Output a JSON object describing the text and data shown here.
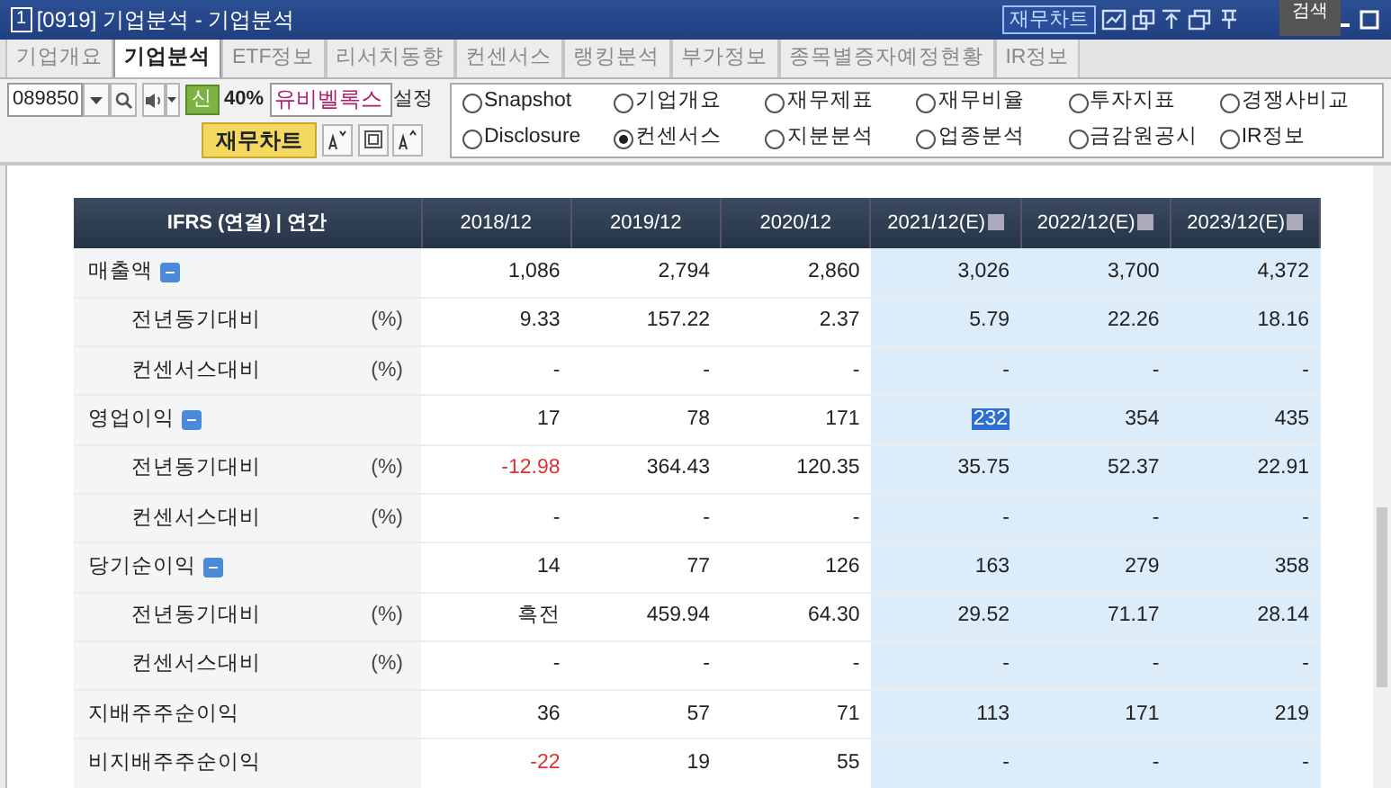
{
  "window": {
    "number": "1",
    "title": "[0919] 기업분석 - 기업분석",
    "chart_button": "재무차트",
    "tooltip": "검색"
  },
  "tabs": [
    {
      "label": "기업개요",
      "selected": false
    },
    {
      "label": "기업분석",
      "selected": true
    },
    {
      "label": "ETF정보",
      "selected": false
    },
    {
      "label": "리서치동향",
      "selected": false
    },
    {
      "label": "컨센서스",
      "selected": false
    },
    {
      "label": "랭킹분석",
      "selected": false
    },
    {
      "label": "부가정보",
      "selected": false
    },
    {
      "label": "종목별증자예정현황",
      "selected": false
    },
    {
      "label": "IR정보",
      "selected": false
    }
  ],
  "stock": {
    "code": "089850",
    "badge": "신",
    "ratio": "40%",
    "name": "유비벨록스",
    "settings": "설정",
    "chart_button": "재무차트"
  },
  "radios": [
    {
      "label": "Snapshot",
      "selected": false
    },
    {
      "label": "기업개요",
      "selected": false
    },
    {
      "label": "재무제표",
      "selected": false
    },
    {
      "label": "재무비율",
      "selected": false
    },
    {
      "label": "투자지표",
      "selected": false
    },
    {
      "label": "경쟁사비교",
      "selected": false
    },
    {
      "label": "Disclosure",
      "selected": false
    },
    {
      "label": "컨센서스",
      "selected": true
    },
    {
      "label": "지분분석",
      "selected": false
    },
    {
      "label": "업종분석",
      "selected": false
    },
    {
      "label": "금감원공시",
      "selected": false
    },
    {
      "label": "IR정보",
      "selected": false
    }
  ],
  "table": {
    "header": "IFRS (연결) | 연간",
    "columns": [
      {
        "label": "2018/12",
        "estimate": false
      },
      {
        "label": "2019/12",
        "estimate": false
      },
      {
        "label": "2020/12",
        "estimate": false
      },
      {
        "label": "2021/12(E)",
        "estimate": true
      },
      {
        "label": "2022/12(E)",
        "estimate": true
      },
      {
        "label": "2023/12(E)",
        "estimate": true
      }
    ],
    "rows": [
      {
        "kind": "main",
        "label": "매출액",
        "collapsible": true,
        "cells": [
          {
            "text": "1,086"
          },
          {
            "text": "2,794"
          },
          {
            "text": "2,860"
          },
          {
            "text": "3,026"
          },
          {
            "text": "3,700"
          },
          {
            "text": "4,372"
          }
        ]
      },
      {
        "kind": "sub",
        "label": "전년동기대비",
        "unit": "(%)",
        "cells": [
          {
            "text": "9.33"
          },
          {
            "text": "157.22"
          },
          {
            "text": "2.37"
          },
          {
            "text": "5.79"
          },
          {
            "text": "22.26"
          },
          {
            "text": "18.16"
          }
        ]
      },
      {
        "kind": "sub",
        "label": "컨센서스대비",
        "unit": "(%)",
        "cells": [
          {
            "text": "-"
          },
          {
            "text": "-"
          },
          {
            "text": "-"
          },
          {
            "text": "-"
          },
          {
            "text": "-"
          },
          {
            "text": "-"
          }
        ]
      },
      {
        "kind": "main",
        "label": "영업이익",
        "collapsible": true,
        "cells": [
          {
            "text": "17"
          },
          {
            "text": "78"
          },
          {
            "text": "171"
          },
          {
            "text": "232",
            "selected": true
          },
          {
            "text": "354"
          },
          {
            "text": "435"
          }
        ]
      },
      {
        "kind": "sub",
        "label": "전년동기대비",
        "unit": "(%)",
        "cells": [
          {
            "text": "-12.98",
            "negative": true
          },
          {
            "text": "364.43"
          },
          {
            "text": "120.35"
          },
          {
            "text": "35.75"
          },
          {
            "text": "52.37"
          },
          {
            "text": "22.91"
          }
        ]
      },
      {
        "kind": "sub",
        "label": "컨센서스대비",
        "unit": "(%)",
        "cells": [
          {
            "text": "-"
          },
          {
            "text": "-"
          },
          {
            "text": "-"
          },
          {
            "text": "-"
          },
          {
            "text": "-"
          },
          {
            "text": "-"
          }
        ]
      },
      {
        "kind": "main",
        "label": "당기순이익",
        "collapsible": true,
        "cells": [
          {
            "text": "14"
          },
          {
            "text": "77"
          },
          {
            "text": "126"
          },
          {
            "text": "163"
          },
          {
            "text": "279"
          },
          {
            "text": "358"
          }
        ]
      },
      {
        "kind": "sub",
        "label": "전년동기대비",
        "unit": "(%)",
        "cells": [
          {
            "text": "흑전"
          },
          {
            "text": "459.94"
          },
          {
            "text": "64.30"
          },
          {
            "text": "29.52"
          },
          {
            "text": "71.17"
          },
          {
            "text": "28.14"
          }
        ]
      },
      {
        "kind": "sub",
        "label": "컨센서스대비",
        "unit": "(%)",
        "cells": [
          {
            "text": "-"
          },
          {
            "text": "-"
          },
          {
            "text": "-"
          },
          {
            "text": "-"
          },
          {
            "text": "-"
          },
          {
            "text": "-"
          }
        ]
      },
      {
        "kind": "main",
        "label": "지배주주순이익",
        "collapsible": false,
        "cells": [
          {
            "text": "36"
          },
          {
            "text": "57"
          },
          {
            "text": "71"
          },
          {
            "text": "113"
          },
          {
            "text": "171"
          },
          {
            "text": "219"
          }
        ]
      },
      {
        "kind": "main",
        "label": "비지배주주순이익",
        "collapsible": false,
        "cells": [
          {
            "text": "-22",
            "negative": true
          },
          {
            "text": "19"
          },
          {
            "text": "55"
          },
          {
            "text": "-"
          },
          {
            "text": "-"
          },
          {
            "text": "-"
          }
        ]
      }
    ]
  }
}
